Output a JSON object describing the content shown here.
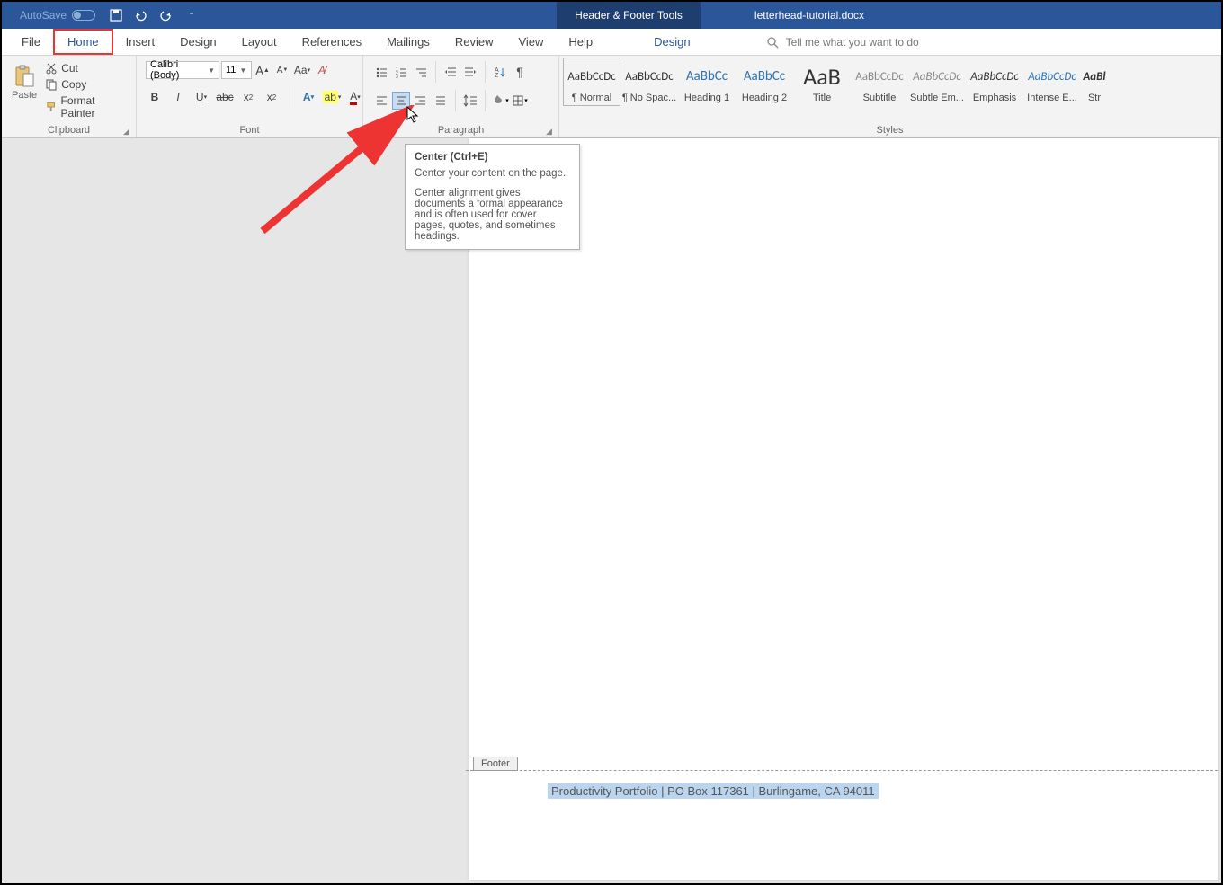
{
  "titlebar": {
    "autosave": "AutoSave",
    "context_tools": "Header & Footer Tools",
    "doc_name": "letterhead-tutorial.docx"
  },
  "tabs": {
    "file": "File",
    "home": "Home",
    "insert": "Insert",
    "design": "Design",
    "layout": "Layout",
    "references": "References",
    "mailings": "Mailings",
    "review": "Review",
    "view": "View",
    "help": "Help",
    "context_design": "Design",
    "tellme_placeholder": "Tell me what you want to do"
  },
  "clipboard": {
    "paste": "Paste",
    "cut": "Cut",
    "copy": "Copy",
    "format_painter": "Format Painter",
    "label": "Clipboard"
  },
  "font": {
    "name": "Calibri (Body)",
    "size": "11",
    "label": "Font"
  },
  "paragraph": {
    "label": "Paragraph"
  },
  "styles": {
    "preview": "AaBbCcDc",
    "preview_blue": "AaBbCc",
    "preview_big": "AaB",
    "normal": "¶ Normal",
    "nospac": "¶ No Spac...",
    "h1": "Heading 1",
    "h2": "Heading 2",
    "title": "Title",
    "subtitle": "Subtitle",
    "subtle_em": "Subtle Em...",
    "emphasis": "Emphasis",
    "intense_e": "Intense E...",
    "strong": "Str",
    "label": "Styles",
    "preview_last": "AaBl"
  },
  "tooltip": {
    "title": "Center (Ctrl+E)",
    "d1": "Center your content on the page.",
    "d2": "Center alignment gives documents a formal appearance and is often used for cover pages, quotes, and sometimes headings."
  },
  "footer": {
    "tab": "Footer",
    "text": "Productivity Portfolio | PO Box 117361 | Burlingame, CA 94011"
  }
}
